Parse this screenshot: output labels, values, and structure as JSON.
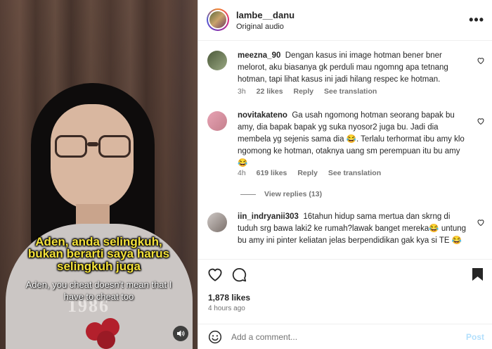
{
  "video": {
    "caption_id": [
      "Aden, anda selingkuh,",
      "bukan berarti saya harus",
      "selingkuh juga"
    ],
    "caption_en": [
      "Aden, you cheat doesn't mean that I",
      "have to cheat too"
    ],
    "shirt_print": "1986",
    "mute_icon": "speaker-icon"
  },
  "header": {
    "username": "lambe__danu",
    "audio": "Original audio",
    "more_label": "•••"
  },
  "comments": [
    {
      "user": "meezna_90",
      "text": "Dengan kasus ini image hotman bener bner melorot, aku biasanya gk perduli mau ngomng apa tetnang hotman, tapi lihat kasus ini jadi hilang respec ke hotman.",
      "time": "3h",
      "likes": "22 likes",
      "reply": "Reply",
      "translate": "See translation"
    },
    {
      "user": "novitakateno",
      "text": "Ga usah ngomong hotman seorang bapak bu amy, dia bapak bapak yg suka nyosor2 juga bu. Jadi dia membela yg sejenis sama dia 😂. Terlalu terhormat ibu amy klo ngomong ke hotman, otaknya uang sm perempuan itu bu amy 😂",
      "time": "4h",
      "likes": "619 likes",
      "reply": "Reply",
      "translate": "See translation",
      "view_replies": "View replies (13)"
    },
    {
      "user": "iin_indryanii303",
      "text": "16tahun hidup sama mertua dan skrng di tuduh srg bawa laki2 ke rumah?lawak banget mereka😂 untung bu amy ini pinter keliatan jelas berpendidikan gak kya si TE 😂"
    }
  ],
  "post": {
    "likes": "1,878 likes",
    "time": "4 hours ago"
  },
  "add_comment": {
    "placeholder": "Add a comment...",
    "post_label": "Post"
  }
}
